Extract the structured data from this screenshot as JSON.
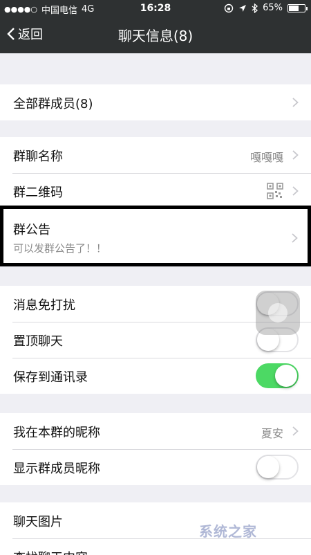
{
  "status_bar": {
    "signal": "●●●●○",
    "carrier": "中国电信",
    "network": "4G",
    "time": "16:28",
    "battery": "65%",
    "battery_level": 0.65
  },
  "nav": {
    "back_label": "返回",
    "title": "聊天信息(8)"
  },
  "sections": {
    "members": {
      "label": "全部群成员(8)"
    },
    "group_name": {
      "label": "群聊名称",
      "value": "嘎嘎嘎"
    },
    "qr_code": {
      "label": "群二维码"
    },
    "notice": {
      "label": "群公告",
      "sub": "可以发群公告了！！"
    },
    "mute": {
      "label": "消息免打扰",
      "on": false
    },
    "pin": {
      "label": "置顶聊天",
      "on": false
    },
    "save_contacts": {
      "label": "保存到通讯录",
      "on": true
    },
    "my_nickname": {
      "label": "我在本群的昵称",
      "value": "夏安"
    },
    "show_nicknames": {
      "label": "显示群成员昵称",
      "on": false
    },
    "chat_images": {
      "label": "聊天图片"
    },
    "search_history": {
      "label": "查找聊天内容"
    }
  },
  "watermark": "系统之家",
  "colors": {
    "nav_bg": "#2e3132",
    "toggle_on": "#4cd964",
    "page_bg": "#efeff4"
  }
}
